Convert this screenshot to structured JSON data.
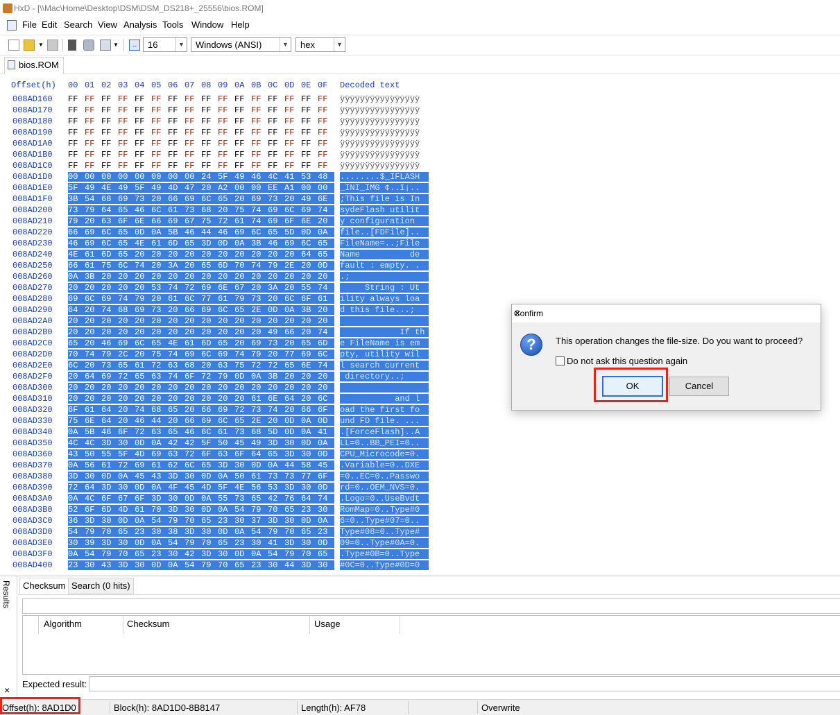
{
  "window": {
    "title": "HxD - [\\\\Mac\\Home\\Desktop\\DSM\\DSM_DS218+_25556\\bios.ROM]"
  },
  "menu": [
    "File",
    "Edit",
    "Search",
    "View",
    "Analysis",
    "Tools",
    "Window",
    "Help"
  ],
  "toolbar": {
    "bytes_per_row": "16",
    "charset": "Windows (ANSI)",
    "display_mode": "hex",
    "icons": [
      "new-file-icon",
      "open-file-icon",
      "save-icon",
      "ram-icon",
      "disk-icon",
      "open-disk-image-icon",
      "bytes-per-row-icon"
    ]
  },
  "file_tab": {
    "label": "bios.ROM"
  },
  "hex_view": {
    "offset_header": "Offset(h)",
    "column_headers": [
      "00",
      "01",
      "02",
      "03",
      "04",
      "05",
      "06",
      "07",
      "08",
      "09",
      "0A",
      "0B",
      "0C",
      "0D",
      "0E",
      "0F"
    ],
    "decoded_header": "Decoded text",
    "rows": [
      {
        "offset": "008AD160",
        "bytes": [
          "FF",
          "FF",
          "FF",
          "FF",
          "FF",
          "FF",
          "FF",
          "FF",
          "FF",
          "FF",
          "FF",
          "FF",
          "FF",
          "FF",
          "FF",
          "FF"
        ],
        "text": "ÿÿÿÿÿÿÿÿÿÿÿÿÿÿÿÿ",
        "selected": false
      },
      {
        "offset": "008AD170",
        "bytes": [
          "FF",
          "FF",
          "FF",
          "FF",
          "FF",
          "FF",
          "FF",
          "FF",
          "FF",
          "FF",
          "FF",
          "FF",
          "FF",
          "FF",
          "FF",
          "FF"
        ],
        "text": "ÿÿÿÿÿÿÿÿÿÿÿÿÿÿÿÿ",
        "selected": false
      },
      {
        "offset": "008AD180",
        "bytes": [
          "FF",
          "FF",
          "FF",
          "FF",
          "FF",
          "FF",
          "FF",
          "FF",
          "FF",
          "FF",
          "FF",
          "FF",
          "FF",
          "FF",
          "FF",
          "FF"
        ],
        "text": "ÿÿÿÿÿÿÿÿÿÿÿÿÿÿÿÿ",
        "selected": false
      },
      {
        "offset": "008AD190",
        "bytes": [
          "FF",
          "FF",
          "FF",
          "FF",
          "FF",
          "FF",
          "FF",
          "FF",
          "FF",
          "FF",
          "FF",
          "FF",
          "FF",
          "FF",
          "FF",
          "FF"
        ],
        "text": "ÿÿÿÿÿÿÿÿÿÿÿÿÿÿÿÿ",
        "selected": false
      },
      {
        "offset": "008AD1A0",
        "bytes": [
          "FF",
          "FF",
          "FF",
          "FF",
          "FF",
          "FF",
          "FF",
          "FF",
          "FF",
          "FF",
          "FF",
          "FF",
          "FF",
          "FF",
          "FF",
          "FF"
        ],
        "text": "ÿÿÿÿÿÿÿÿÿÿÿÿÿÿÿÿ",
        "selected": false
      },
      {
        "offset": "008AD1B0",
        "bytes": [
          "FF",
          "FF",
          "FF",
          "FF",
          "FF",
          "FF",
          "FF",
          "FF",
          "FF",
          "FF",
          "FF",
          "FF",
          "FF",
          "FF",
          "FF",
          "FF"
        ],
        "text": "ÿÿÿÿÿÿÿÿÿÿÿÿÿÿÿÿ",
        "selected": false
      },
      {
        "offset": "008AD1C0",
        "bytes": [
          "FF",
          "FF",
          "FF",
          "FF",
          "FF",
          "FF",
          "FF",
          "FF",
          "FF",
          "FF",
          "FF",
          "FF",
          "FF",
          "FF",
          "FF",
          "FF"
        ],
        "text": "ÿÿÿÿÿÿÿÿÿÿÿÿÿÿÿÿ",
        "selected": false
      },
      {
        "offset": "008AD1D0",
        "bytes": [
          "00",
          "00",
          "00",
          "00",
          "00",
          "00",
          "00",
          "00",
          "24",
          "5F",
          "49",
          "46",
          "4C",
          "41",
          "53",
          "48"
        ],
        "text": "........$_IFLASH",
        "selected": true
      },
      {
        "offset": "008AD1E0",
        "bytes": [
          "5F",
          "49",
          "4E",
          "49",
          "5F",
          "49",
          "4D",
          "47",
          "20",
          "A2",
          "00",
          "00",
          "EE",
          "A1",
          "00",
          "00"
        ],
        "text": "_INI_IMG ¢..î¡..",
        "selected": true
      },
      {
        "offset": "008AD1F0",
        "bytes": [
          "3B",
          "54",
          "68",
          "69",
          "73",
          "20",
          "66",
          "69",
          "6C",
          "65",
          "20",
          "69",
          "73",
          "20",
          "49",
          "6E"
        ],
        "text": ";This file is In",
        "selected": true
      },
      {
        "offset": "008AD200",
        "bytes": [
          "73",
          "79",
          "64",
          "65",
          "46",
          "6C",
          "61",
          "73",
          "68",
          "20",
          "75",
          "74",
          "69",
          "6C",
          "69",
          "74"
        ],
        "text": "sydeFlash utilit",
        "selected": true
      },
      {
        "offset": "008AD210",
        "bytes": [
          "79",
          "20",
          "63",
          "6F",
          "6E",
          "66",
          "69",
          "67",
          "75",
          "72",
          "61",
          "74",
          "69",
          "6F",
          "6E",
          "20"
        ],
        "text": "y configuration ",
        "selected": true
      },
      {
        "offset": "008AD220",
        "bytes": [
          "66",
          "69",
          "6C",
          "65",
          "0D",
          "0A",
          "5B",
          "46",
          "44",
          "46",
          "69",
          "6C",
          "65",
          "5D",
          "0D",
          "0A"
        ],
        "text": "file..[FDFile]..",
        "selected": true
      },
      {
        "offset": "008AD230",
        "bytes": [
          "46",
          "69",
          "6C",
          "65",
          "4E",
          "61",
          "6D",
          "65",
          "3D",
          "0D",
          "0A",
          "3B",
          "46",
          "69",
          "6C",
          "65"
        ],
        "text": "FileName=..;File",
        "selected": true
      },
      {
        "offset": "008AD240",
        "bytes": [
          "4E",
          "61",
          "6D",
          "65",
          "20",
          "20",
          "20",
          "20",
          "20",
          "20",
          "20",
          "20",
          "20",
          "20",
          "64",
          "65"
        ],
        "text": "Name          de",
        "selected": true
      },
      {
        "offset": "008AD250",
        "bytes": [
          "66",
          "61",
          "75",
          "6C",
          "74",
          "20",
          "3A",
          "20",
          "65",
          "6D",
          "70",
          "74",
          "79",
          "2E",
          "20",
          "0D"
        ],
        "text": "fault : empty. .",
        "selected": true
      },
      {
        "offset": "008AD260",
        "bytes": [
          "0A",
          "3B",
          "20",
          "20",
          "20",
          "20",
          "20",
          "20",
          "20",
          "20",
          "20",
          "20",
          "20",
          "20",
          "20",
          "20"
        ],
        "text": ".;              ",
        "selected": true
      },
      {
        "offset": "008AD270",
        "bytes": [
          "20",
          "20",
          "20",
          "20",
          "20",
          "53",
          "74",
          "72",
          "69",
          "6E",
          "67",
          "20",
          "3A",
          "20",
          "55",
          "74"
        ],
        "text": "     String : Ut",
        "selected": true
      },
      {
        "offset": "008AD280",
        "bytes": [
          "69",
          "6C",
          "69",
          "74",
          "79",
          "20",
          "61",
          "6C",
          "77",
          "61",
          "79",
          "73",
          "20",
          "6C",
          "6F",
          "61"
        ],
        "text": "ility always loa",
        "selected": true
      },
      {
        "offset": "008AD290",
        "bytes": [
          "64",
          "20",
          "74",
          "68",
          "69",
          "73",
          "20",
          "66",
          "69",
          "6C",
          "65",
          "2E",
          "0D",
          "0A",
          "3B",
          "20"
        ],
        "text": "d this file...; ",
        "selected": true
      },
      {
        "offset": "008AD2A0",
        "bytes": [
          "20",
          "20",
          "20",
          "20",
          "20",
          "20",
          "20",
          "20",
          "20",
          "20",
          "20",
          "20",
          "20",
          "20",
          "20",
          "20"
        ],
        "text": "                ",
        "selected": true
      },
      {
        "offset": "008AD2B0",
        "bytes": [
          "20",
          "20",
          "20",
          "20",
          "20",
          "20",
          "20",
          "20",
          "20",
          "20",
          "20",
          "20",
          "49",
          "66",
          "20",
          "74"
        ],
        "text": "            If th",
        "selected": true
      },
      {
        "offset": "008AD2C0",
        "bytes": [
          "65",
          "20",
          "46",
          "69",
          "6C",
          "65",
          "4E",
          "61",
          "6D",
          "65",
          "20",
          "69",
          "73",
          "20",
          "65",
          "6D"
        ],
        "text": "e FileName is em",
        "selected": true
      },
      {
        "offset": "008AD2D0",
        "bytes": [
          "70",
          "74",
          "79",
          "2C",
          "20",
          "75",
          "74",
          "69",
          "6C",
          "69",
          "74",
          "79",
          "20",
          "77",
          "69",
          "6C"
        ],
        "text": "pty, utility wil",
        "selected": true
      },
      {
        "offset": "008AD2E0",
        "bytes": [
          "6C",
          "20",
          "73",
          "65",
          "61",
          "72",
          "63",
          "68",
          "20",
          "63",
          "75",
          "72",
          "72",
          "65",
          "6E",
          "74"
        ],
        "text": "l search current",
        "selected": true
      },
      {
        "offset": "008AD2F0",
        "bytes": [
          "20",
          "64",
          "69",
          "72",
          "65",
          "63",
          "74",
          "6F",
          "72",
          "79",
          "0D",
          "0A",
          "3B",
          "20",
          "20",
          "20"
        ],
        "text": " directory..;   ",
        "selected": true
      },
      {
        "offset": "008AD300",
        "bytes": [
          "20",
          "20",
          "20",
          "20",
          "20",
          "20",
          "20",
          "20",
          "20",
          "20",
          "20",
          "20",
          "20",
          "20",
          "20",
          "20"
        ],
        "text": "                ",
        "selected": true
      },
      {
        "offset": "008AD310",
        "bytes": [
          "20",
          "20",
          "20",
          "20",
          "20",
          "20",
          "20",
          "20",
          "20",
          "20",
          "20",
          "61",
          "6E",
          "64",
          "20",
          "6C"
        ],
        "text": "           and l",
        "selected": true
      },
      {
        "offset": "008AD320",
        "bytes": [
          "6F",
          "61",
          "64",
          "20",
          "74",
          "68",
          "65",
          "20",
          "66",
          "69",
          "72",
          "73",
          "74",
          "20",
          "66",
          "6F"
        ],
        "text": "oad the first fo",
        "selected": true
      },
      {
        "offset": "008AD330",
        "bytes": [
          "75",
          "6E",
          "64",
          "20",
          "46",
          "44",
          "20",
          "66",
          "69",
          "6C",
          "65",
          "2E",
          "20",
          "0D",
          "0A",
          "0D"
        ],
        "text": "und FD file. ...",
        "selected": true
      },
      {
        "offset": "008AD340",
        "bytes": [
          "0A",
          "5B",
          "46",
          "6F",
          "72",
          "63",
          "65",
          "46",
          "6C",
          "61",
          "73",
          "68",
          "5D",
          "0D",
          "0A",
          "41"
        ],
        "text": ".[ForceFlash]..A",
        "selected": true
      },
      {
        "offset": "008AD350",
        "bytes": [
          "4C",
          "4C",
          "3D",
          "30",
          "0D",
          "0A",
          "42",
          "42",
          "5F",
          "50",
          "45",
          "49",
          "3D",
          "30",
          "0D",
          "0A"
        ],
        "text": "LL=0..BB_PEI=0..",
        "selected": true
      },
      {
        "offset": "008AD360",
        "bytes": [
          "43",
          "50",
          "55",
          "5F",
          "4D",
          "69",
          "63",
          "72",
          "6F",
          "63",
          "6F",
          "64",
          "65",
          "3D",
          "30",
          "0D"
        ],
        "text": "CPU_Microcode=0.",
        "selected": true
      },
      {
        "offset": "008AD370",
        "bytes": [
          "0A",
          "56",
          "61",
          "72",
          "69",
          "61",
          "62",
          "6C",
          "65",
          "3D",
          "30",
          "0D",
          "0A",
          "44",
          "58",
          "45"
        ],
        "text": ".Variable=0..DXE",
        "selected": true
      },
      {
        "offset": "008AD380",
        "bytes": [
          "3D",
          "30",
          "0D",
          "0A",
          "45",
          "43",
          "3D",
          "30",
          "0D",
          "0A",
          "50",
          "61",
          "73",
          "73",
          "77",
          "6F"
        ],
        "text": "=0..EC=0..Passwo",
        "selected": true
      },
      {
        "offset": "008AD390",
        "bytes": [
          "72",
          "64",
          "3D",
          "30",
          "0D",
          "0A",
          "4F",
          "45",
          "4D",
          "5F",
          "4E",
          "56",
          "53",
          "3D",
          "30",
          "0D"
        ],
        "text": "rd=0..OEM_NVS=0.",
        "selected": true
      },
      {
        "offset": "008AD3A0",
        "bytes": [
          "0A",
          "4C",
          "6F",
          "67",
          "6F",
          "3D",
          "30",
          "0D",
          "0A",
          "55",
          "73",
          "65",
          "42",
          "76",
          "64",
          "74"
        ],
        "text": ".Logo=0..UseBvdt",
        "selected": true
      },
      {
        "offset": "008AD3B0",
        "bytes": [
          "52",
          "6F",
          "6D",
          "4D",
          "61",
          "70",
          "3D",
          "30",
          "0D",
          "0A",
          "54",
          "79",
          "70",
          "65",
          "23",
          "30"
        ],
        "text": "RomMap=0..Type#0",
        "selected": true
      },
      {
        "offset": "008AD3C0",
        "bytes": [
          "36",
          "3D",
          "30",
          "0D",
          "0A",
          "54",
          "79",
          "70",
          "65",
          "23",
          "30",
          "37",
          "3D",
          "30",
          "0D",
          "0A"
        ],
        "text": "6=0..Type#07=0..",
        "selected": true
      },
      {
        "offset": "008AD3D0",
        "bytes": [
          "54",
          "79",
          "70",
          "65",
          "23",
          "30",
          "38",
          "3D",
          "30",
          "0D",
          "0A",
          "54",
          "79",
          "70",
          "65",
          "23"
        ],
        "text": "Type#08=0..Type#",
        "selected": true
      },
      {
        "offset": "008AD3E0",
        "bytes": [
          "30",
          "39",
          "3D",
          "30",
          "0D",
          "0A",
          "54",
          "79",
          "70",
          "65",
          "23",
          "30",
          "41",
          "3D",
          "30",
          "0D"
        ],
        "text": "09=0..Type#0A=0.",
        "selected": true
      },
      {
        "offset": "008AD3F0",
        "bytes": [
          "0A",
          "54",
          "79",
          "70",
          "65",
          "23",
          "30",
          "42",
          "3D",
          "30",
          "0D",
          "0A",
          "54",
          "79",
          "70",
          "65"
        ],
        "text": ".Type#0B=0..Type",
        "selected": true
      },
      {
        "offset": "008AD400",
        "bytes": [
          "23",
          "30",
          "43",
          "3D",
          "30",
          "0D",
          "0A",
          "54",
          "79",
          "70",
          "65",
          "23",
          "30",
          "44",
          "3D",
          "30"
        ],
        "text": "#0C=0..Type#0D=0",
        "selected": true
      }
    ]
  },
  "results_panel": {
    "vertical_label": "Results",
    "close_glyph": "×",
    "tabs": [
      "Checksum",
      "Search (0 hits)"
    ],
    "columns": [
      "Algorithm",
      "Checksum",
      "Usage"
    ],
    "expected_label": "Expected result:"
  },
  "statusbar": {
    "offset": "Offset(h): 8AD1D0",
    "block": "Block(h): 8AD1D0-8B8147",
    "length": "Length(h): AF78",
    "mode": "Overwrite"
  },
  "dialog": {
    "title": "Confirm",
    "close_glyph": "✕",
    "message": "This operation changes the file-size. Do you want to proceed?",
    "checkbox_label": "Do not ask this question again",
    "checkbox_checked": false,
    "ok_label": "OK",
    "cancel_label": "Cancel",
    "icon_glyph": "?"
  },
  "colors": {
    "selection": "#3a7fe0",
    "offset_text": "#1a3fb0",
    "highlight_box": "#e5241c"
  }
}
